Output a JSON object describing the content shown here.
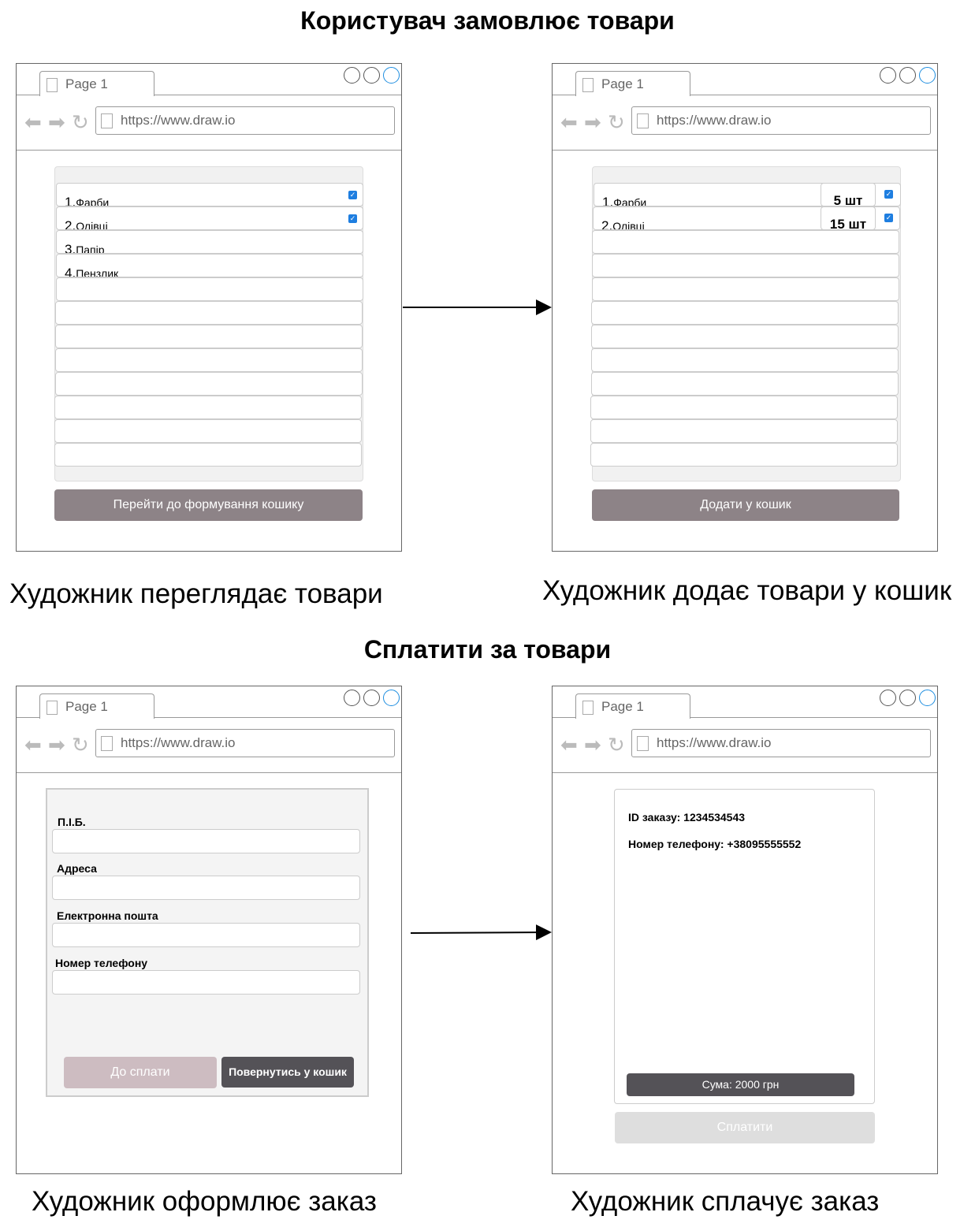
{
  "headings": {
    "top": "Користувач замовлює товари",
    "bottom": "Сплатити за товари"
  },
  "browser": {
    "tab_label": "Page 1",
    "url": "https://www.draw.io"
  },
  "captions": {
    "browse": "Художник переглядає товари",
    "add": "Художник додає товари у кошик",
    "order": "Художник оформлює заказ",
    "pay": "Художник сплачує заказ"
  },
  "browse_screen": {
    "items": [
      {
        "num": "1.",
        "name": "Фарби",
        "checked": true
      },
      {
        "num": "2.",
        "name": "Олівці",
        "checked": true
      },
      {
        "num": "3.",
        "name": "Папір",
        "checked": false
      },
      {
        "num": "4.",
        "name": "Пензлик",
        "checked": false
      }
    ],
    "button": "Перейти до формування кошику"
  },
  "cart_screen": {
    "items": [
      {
        "num": "1.",
        "name": "Фарби",
        "qty": "5 шт",
        "checked": true
      },
      {
        "num": "2.",
        "name": "Олівці",
        "qty": "15 шт",
        "checked": true
      }
    ],
    "button": "Додати у кошик"
  },
  "order_screen": {
    "fields": [
      "П.І.Б.",
      "Адреса",
      "Електронна пошта",
      "Номер телефону"
    ],
    "pay_button": "До сплати",
    "back_button": "Повернутись у кошик"
  },
  "pay_screen": {
    "order_id": "ID заказу: 1234534543",
    "phone": "Номер телефону: +38095555552",
    "sum": "Сума: 2000 грн",
    "pay_button": "Сплатити"
  },
  "colors": {
    "browse_button": "#8d8387",
    "cart_button": "#8d8387",
    "pay_form_button": "#cdbcc1",
    "back_button": "#545257",
    "sum_bar": "#545257",
    "pay_button_disabled": "#dedede",
    "checkbox": "#1e7ee0",
    "window_max_button": "#1e8ee0"
  }
}
